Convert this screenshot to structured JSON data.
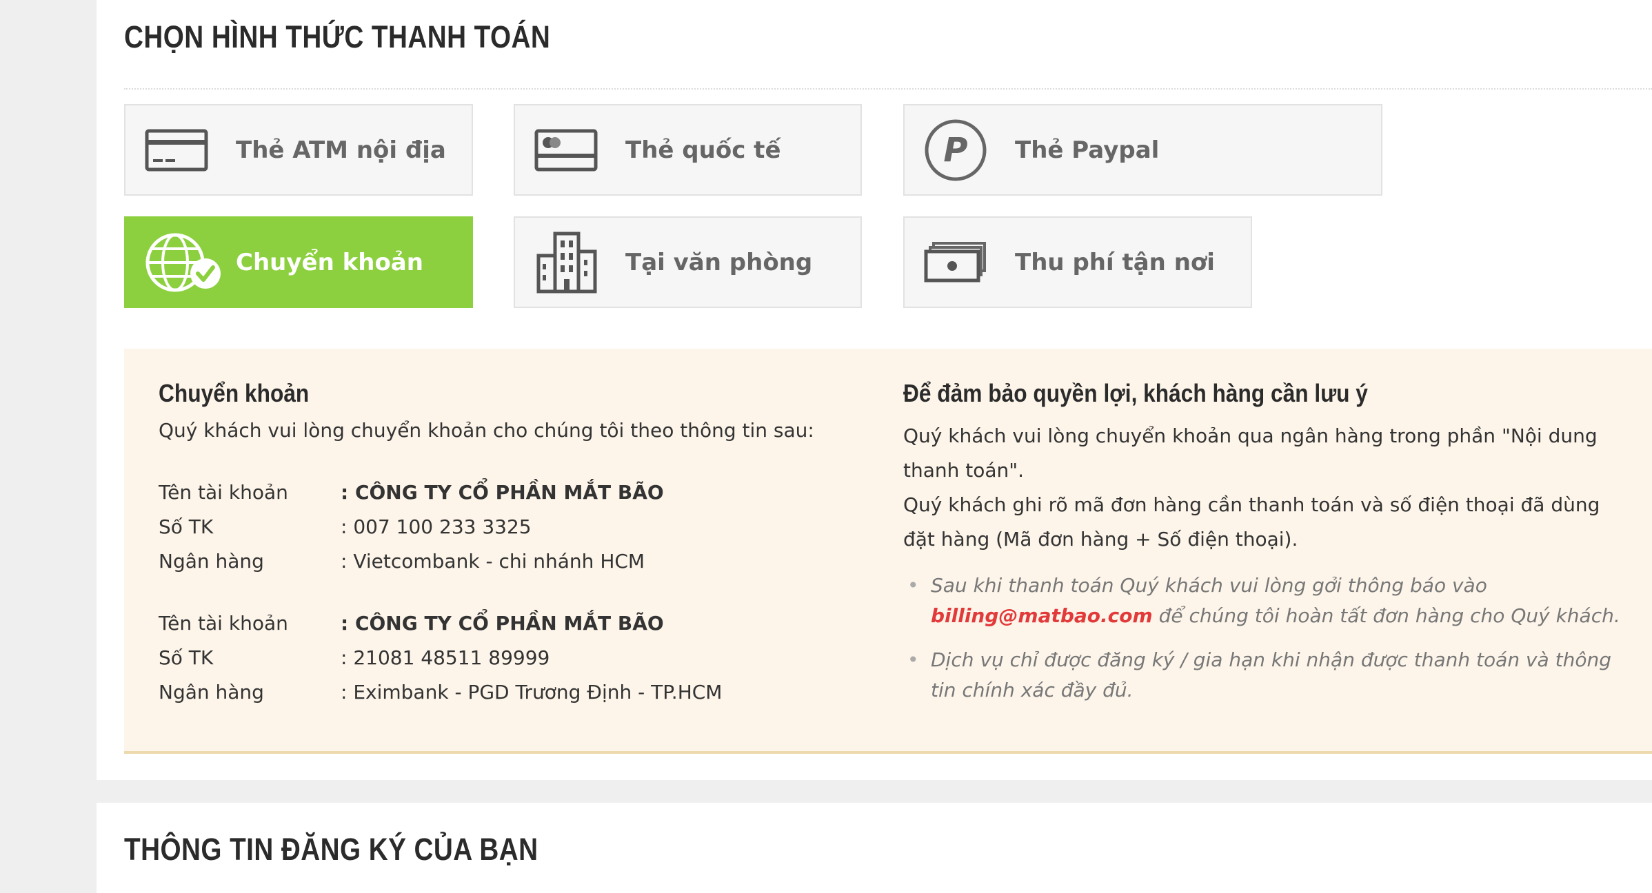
{
  "payment": {
    "title": "CHỌN HÌNH THỨC THANH TOÁN",
    "options": [
      {
        "label": "Thẻ ATM nội địa",
        "icon": "atm-card-icon"
      },
      {
        "label": "Thẻ quốc tế",
        "icon": "credit-card-icon"
      },
      {
        "label": "Thẻ Paypal",
        "icon": "paypal-icon"
      },
      {
        "label": "Chuyển khoản",
        "icon": "globe-transfer-icon",
        "selected": true
      },
      {
        "label": "Tại văn phòng",
        "icon": "office-building-icon"
      },
      {
        "label": "Thu phí tận nơi",
        "icon": "cash-icon"
      }
    ],
    "active_color": "#8cd03f"
  },
  "transfer": {
    "title": "Chuyển khoản",
    "intro": "Quý khách vui lòng chuyển khoản cho chúng tôi theo thông tin sau:",
    "accounts": [
      {
        "name_label": "Tên tài khoản",
        "name_value": ": CÔNG TY CỔ PHẦN MẮT BÃO",
        "number_label": "Số TK",
        "number_value": ": 007 100 233 3325",
        "bank_label": "Ngân hàng",
        "bank_value": ": Vietcombank - chi nhánh HCM"
      },
      {
        "name_label": "Tên tài khoản",
        "name_value": ": CÔNG TY CỔ PHẦN MẮT BÃO",
        "number_label": "Số TK",
        "number_value": ": 21081 48511 89999",
        "bank_label": "Ngân hàng",
        "bank_value": ": Eximbank - PGD Trương Định - TP.HCM"
      }
    ]
  },
  "notice": {
    "title": "Để đảm bảo quyền lợi, khách hàng cần lưu ý",
    "paragraph1": "Quý khách vui lòng chuyển khoản qua ngân hàng trong phần \"Nội dung thanh toán\".",
    "paragraph2": "Quý khách ghi rõ mã đơn hàng cần thanh toán và số điện thoại đã dùng đặt hàng (Mã đơn hàng + Số điện thoại).",
    "bullet1_before": "Sau khi thanh toán Quý khách vui lòng gởi thông báo vào",
    "bullet1_email": "billing@matbao.com",
    "bullet1_after": " để chúng tôi hoàn tất đơn hàng cho Quý khách.",
    "bullet2": "Dịch vụ chỉ được đăng ký / gia hạn khi nhận được thanh toán và thông tin chính xác đầy đủ.",
    "email_color": "#e23a3a"
  },
  "registration": {
    "title": "THÔNG TIN ĐĂNG KÝ CỦA BẠN"
  }
}
